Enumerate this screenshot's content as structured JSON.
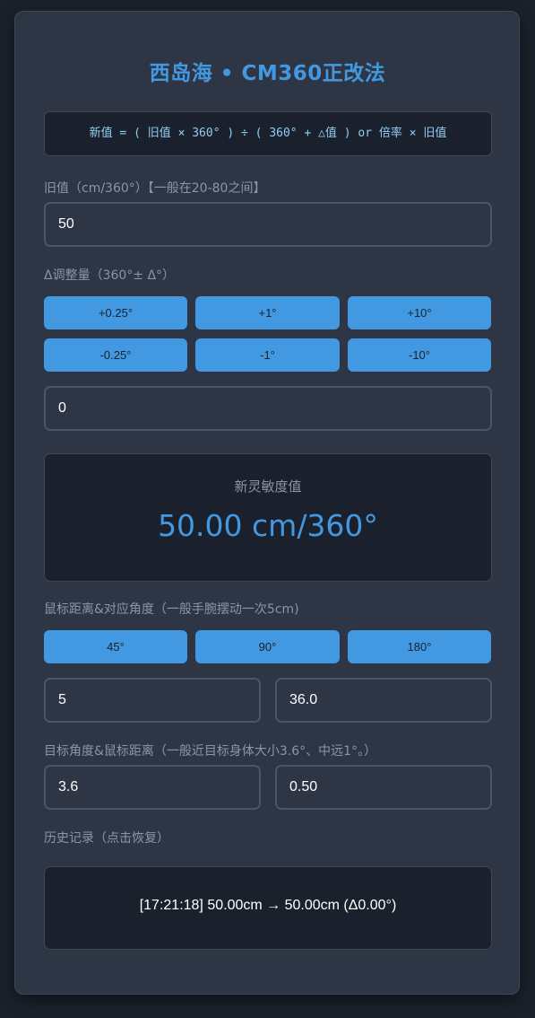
{
  "title": "西岛海 • CM360正改法",
  "formula": "新值 = ( 旧值 × 360° ) ÷ ( 360° + △值 ) or 倍率 × 旧值",
  "old_value": {
    "label": "旧值（cm/360°）【一般在20-80之间】",
    "value": "50"
  },
  "adjust": {
    "label": "Δ调整量（360°± Δ°）",
    "buttons": [
      "+0.25°",
      "+1°",
      "+10°",
      "-0.25°",
      "-1°",
      "-10°"
    ],
    "value": "0"
  },
  "result": {
    "label": "新灵敏度值",
    "value": "50.00 cm/360°"
  },
  "mouse_angle": {
    "label": "鼠标距离&对应角度（一般手腕摆动一次5cm)",
    "buttons": [
      "45°",
      "90°",
      "180°"
    ],
    "distance": "5",
    "angle": "36.0"
  },
  "target": {
    "label": "目标角度&鼠标距离（一般近目标身体大小3.6°、中远1°。）",
    "angle": "3.6",
    "distance": "0.50"
  },
  "history": {
    "label": "历史记录（点击恢复）",
    "items": [
      "[17:21:18] 50.00cm → 50.00cm (Δ0.00°)"
    ]
  },
  "colors": {
    "accent": "#4299e1",
    "background": "#1b212b",
    "card": "#2e3646"
  }
}
